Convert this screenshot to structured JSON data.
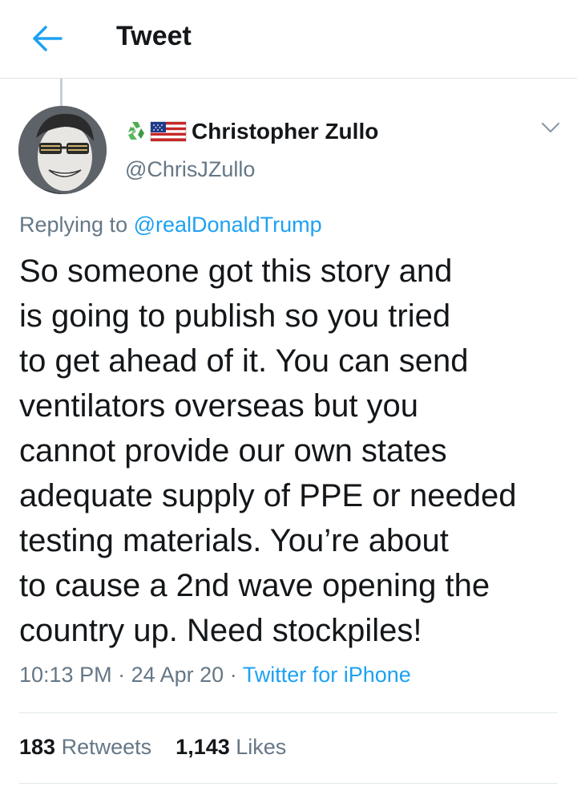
{
  "header": {
    "title": "Tweet",
    "back_icon": "arrow-left-icon"
  },
  "user": {
    "display_name": "Christopher Zullo",
    "handle": "@ChrisJZullo",
    "badges": [
      "recycle-icon",
      "us-flag-icon"
    ],
    "menu_icon": "chevron-down-icon"
  },
  "reply": {
    "prefix": "Replying to",
    "mention": "@realDonaldTrump"
  },
  "tweet": {
    "lines": [
      "So someone got this story and",
      "is going to publish so you tried",
      "to get ahead of it. You can send",
      "ventilators overseas but you",
      "cannot provide our own states",
      "adequate supply of PPE or needed",
      "testing materials. You’re about",
      "to cause a 2nd wave opening the",
      "country up. Need stockpiles!"
    ]
  },
  "meta": {
    "time": "10:13 PM",
    "date": "24 Apr 20",
    "separator": "·",
    "source": "Twitter for iPhone"
  },
  "stats": {
    "retweets_count": "183",
    "retweets_label": "Retweets",
    "likes_count": "1,143",
    "likes_label": "Likes"
  },
  "colors": {
    "accent": "#1da1f2",
    "secondary_text": "#657786",
    "primary_text": "#14171a",
    "divider": "#e1e8ed"
  }
}
